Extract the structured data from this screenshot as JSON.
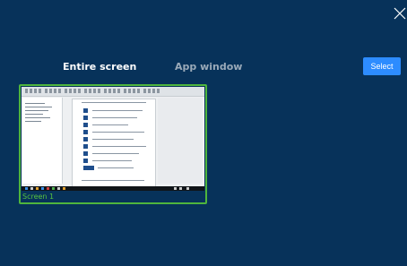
{
  "dialog": {
    "tabs": [
      {
        "label": "Entire screen",
        "active": true
      },
      {
        "label": "App window",
        "active": false
      }
    ],
    "select_label": "Select",
    "screens": [
      {
        "label": "Screen 1",
        "selected": true
      }
    ]
  },
  "colors": {
    "background": "#07325a",
    "accent": "#2d8cff",
    "selection_border": "#4fb53d",
    "inactive_tab": "#9aaab9"
  },
  "icons": {
    "close": "close-icon"
  }
}
